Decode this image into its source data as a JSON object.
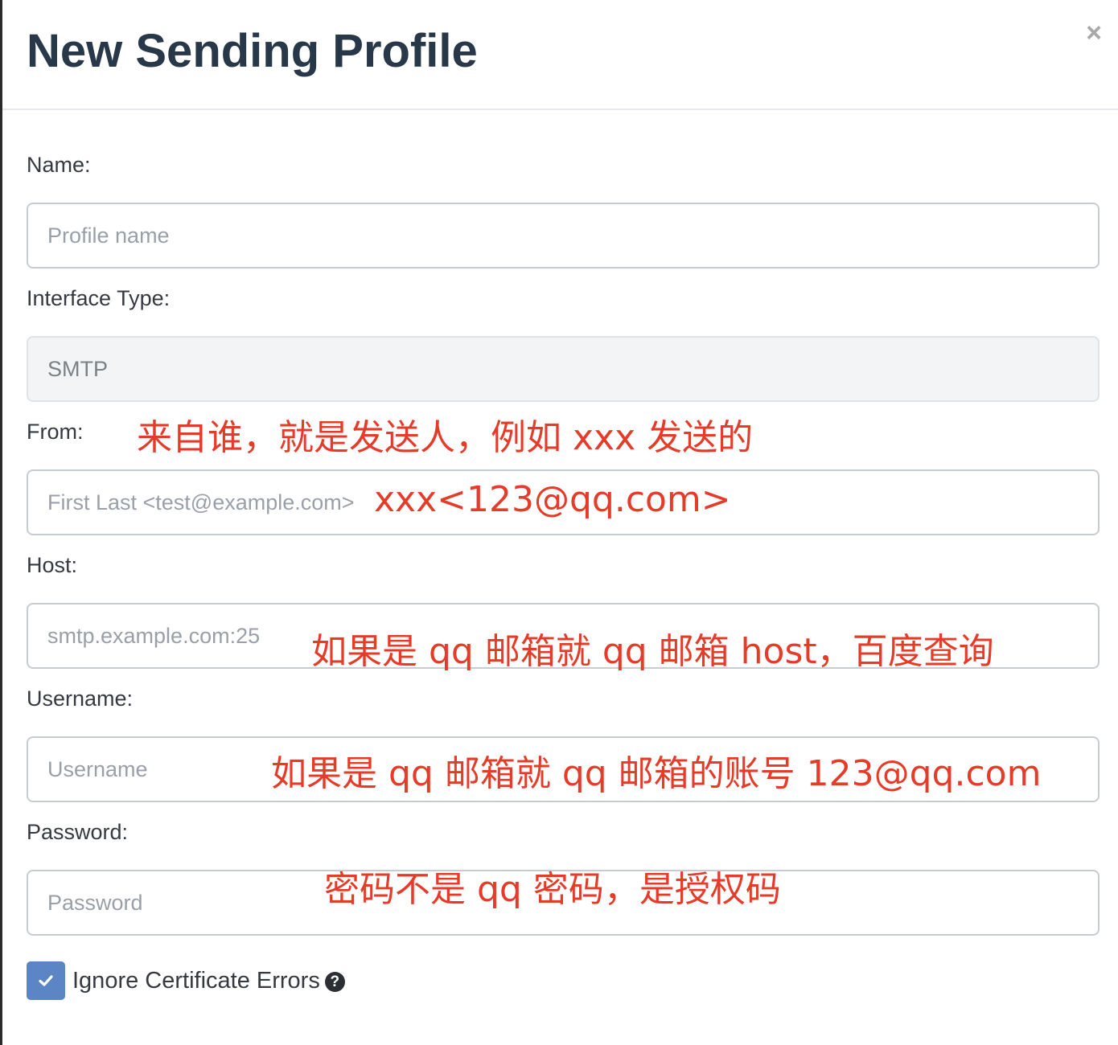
{
  "modal": {
    "title": "New Sending Profile",
    "close_label": "×"
  },
  "form": {
    "name": {
      "label": "Name:",
      "placeholder": "Profile name",
      "value": ""
    },
    "interface_type": {
      "label": "Interface Type:",
      "value": "SMTP"
    },
    "from": {
      "label": "From:",
      "placeholder": "First Last <test@example.com>",
      "value": ""
    },
    "host": {
      "label": "Host:",
      "placeholder": "smtp.example.com:25",
      "value": ""
    },
    "username": {
      "label": "Username:",
      "placeholder": "Username",
      "value": ""
    },
    "password": {
      "label": "Password:",
      "placeholder": "Password",
      "value": ""
    },
    "ignore_cert": {
      "label": "Ignore Certificate Errors",
      "checked": true,
      "help_icon": "question-circle-icon"
    }
  },
  "annotations": {
    "from_note": "来自谁，就是发送人，例如 xxx 发送的",
    "from_example": "xxx<123@qq.com>",
    "host_note": "如果是 qq 邮箱就 qq 邮箱 host，百度查询",
    "username_note": "如果是 qq 邮箱就 qq 邮箱的账号 123@qq.com",
    "password_note": "密码不是 qq 密码，是授权码"
  },
  "colors": {
    "title": "#283848",
    "annotation": "#e53c2a",
    "checkbox": "#5b85c4",
    "input_border": "#c6ccd2"
  }
}
